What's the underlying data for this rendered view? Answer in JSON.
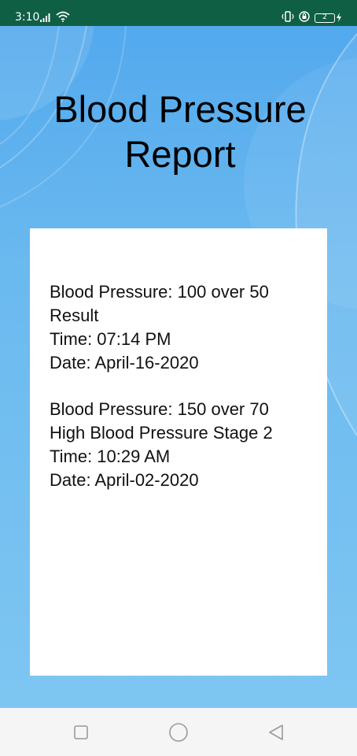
{
  "status_bar": {
    "time": "3:10",
    "battery_level": "2",
    "background_color": "#0f5f45"
  },
  "page": {
    "title": "Blood Pressure Report"
  },
  "report": {
    "entries": [
      {
        "pressure": "Blood Pressure: 100 over 50",
        "result": "Result",
        "time": "Time: 07:14 PM",
        "date": "Date: April-16-2020"
      },
      {
        "pressure": "Blood Pressure: 150 over 70",
        "result": "High Blood Pressure Stage 2",
        "time": "Time: 10:29 AM",
        "date": "Date: April-02-2020"
      }
    ]
  },
  "nav_bar": {
    "buttons": [
      "recents-button",
      "home-button",
      "back-button"
    ]
  },
  "colors": {
    "background_top": "#53a9ee",
    "background_bottom": "#7ec6f2",
    "card": "#ffffff",
    "text": "#000000"
  }
}
